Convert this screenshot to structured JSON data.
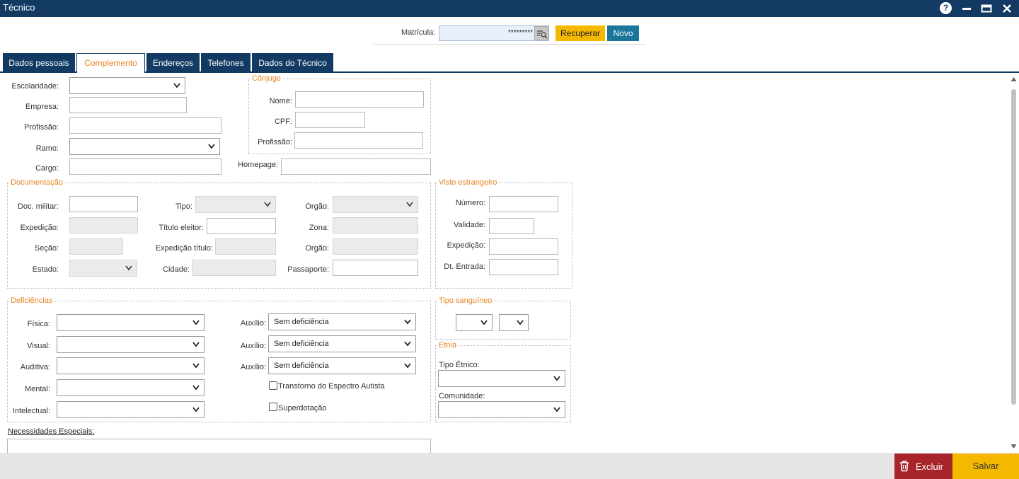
{
  "window": {
    "title": "Técnico",
    "help_glyph": "?"
  },
  "matricula": {
    "label": "Matrícula:",
    "value": "*********",
    "recover_label": "Recuperar",
    "new_label": "Novo"
  },
  "tabs": [
    "Dados pessoais",
    "Complemento",
    "Endereços",
    "Telefones",
    "Dados do Técnico"
  ],
  "complemento": {
    "escolaridade_label": "Escolaridade:",
    "empresa_label": "Empresa:",
    "profissao_label": "Profissão:",
    "ramo_label": "Ramo:",
    "cargo_label": "Cargo:",
    "homepage_label": "Homepage:"
  },
  "conjuge": {
    "legend": "Cônjuge",
    "nome_label": "Nome:",
    "cpf_label": "CPF:",
    "profissao_label": "Profissão:"
  },
  "documentacao": {
    "legend": "Documentação",
    "doc_militar_label": "Doc. militar:",
    "expedicao_label": "Expedição:",
    "secao_label": "Seção:",
    "estado_label": "Estado:",
    "tipo_label": "Tipo:",
    "titulo_eleitor_label": "Título eleitor:",
    "expedicao_titulo_label": "Expedição título:",
    "cidade_label": "Cidade:",
    "orgao1_label": "Órgão:",
    "zona_label": "Zona:",
    "orgao2_label": "Orgão:",
    "passaporte_label": "Passaporte:"
  },
  "visto": {
    "legend": "Visto estrangeiro",
    "numero_label": "Número:",
    "validade_label": "Validade:",
    "expedicao_label": "Expedição:",
    "dt_entrada_label": "Dt. Entrada:"
  },
  "deficiencias": {
    "legend": "Deficiências",
    "fisica_label": "Física:",
    "visual_label": "Visual:",
    "auditiva_label": "Auditiva:",
    "mental_label": "Mental:",
    "intelectual_label": "Intelectual:",
    "auxilio_label": "Auxílio:",
    "auxilio_value": "Sem deficiência",
    "tea_label": "Transtorno do Espectro Autista",
    "superdotacao_label": "Superdotação"
  },
  "tipo_sanguineo": {
    "legend": "Tipo sanguíneo"
  },
  "etnia": {
    "legend": "Etnia",
    "tipo_etnico_label": "Tipo Étnico:",
    "comunidade_label": "Comunidade:"
  },
  "necessidades": {
    "label": "Necessidades Especiais:"
  },
  "actions": {
    "delete_label": "Excluir",
    "save_label": "Salvar"
  },
  "colors": {
    "titlebar": "#123a63",
    "accent_orange": "#e8821d",
    "recover_yellow": "#f5b800",
    "new_teal": "#1a7799",
    "delete_red": "#a8262b",
    "save_yellow": "#f5b800"
  },
  "icons": [
    "help-icon",
    "minimize-icon",
    "maximize-icon",
    "close-icon",
    "search-list-icon",
    "chevron-down-icon",
    "trash-icon",
    "scroll-up-icon",
    "scroll-down-icon"
  ]
}
